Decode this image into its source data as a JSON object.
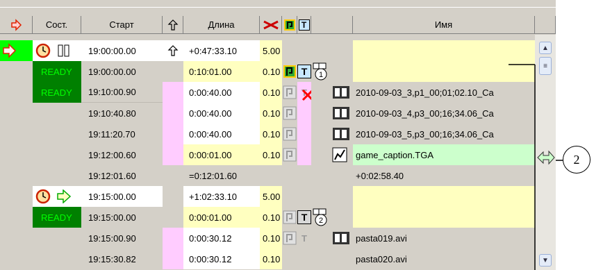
{
  "header": {
    "state": "Сост.",
    "start": "Старт",
    "length": "Длина",
    "name": "Имя"
  },
  "rows": [
    {
      "start": "19:00:00.00",
      "length": "+0:47:33.10",
      "speed": "5.00",
      "name": ""
    },
    {
      "state": "READY",
      "start": "19:00:00.00",
      "length": "0:10:01.00",
      "speed": "0.10",
      "name": ""
    },
    {
      "state": "READY",
      "start": "19:10:00.90",
      "length": "0:00:40.00",
      "speed": "0.10",
      "name": "2010-09-03_3,p1_00;01;02.10_Ca"
    },
    {
      "start": "19:10:40.80",
      "length": "0:00:40.00",
      "speed": "0.10",
      "name": "2010-09-03_4,p3_00;16;34.06_Ca"
    },
    {
      "start": "19:11:20.70",
      "length": "0:00:40.00",
      "speed": "0.10",
      "name": "2010-09-03_5,p3_00;16;34.06_Ca"
    },
    {
      "start": "19:12:00.60",
      "length": "0:00:01.00",
      "speed": "0.10",
      "name": "game_caption.TGA"
    },
    {
      "start": "19:12:01.60",
      "length": "=0:12:01.60",
      "speed": "",
      "name": "+0:02:58.40"
    },
    {
      "start": "19:15:00.00",
      "length": "+1:02:33.10",
      "speed": "5.00",
      "name": ""
    },
    {
      "state": "READY",
      "start": "19:15:00.00",
      "length": "0:00:01.00",
      "speed": "0.10",
      "name": ""
    },
    {
      "start": "19:15:00.90",
      "length": "0:00:30.12",
      "speed": "0.10",
      "name": "pasta019.avi"
    },
    {
      "start": "19:15:30.82",
      "length": "0:00:30.12",
      "speed": "0.10",
      "name": "pasta020.avi"
    }
  ],
  "badges": {
    "one": "1",
    "two": "2"
  },
  "t_label": "T",
  "callout": "2",
  "colors": {
    "ready_bg": "#008000",
    "ready_fg": "#00ff00",
    "time_yellow": "#ffffc0",
    "pink": "#ffccff",
    "green": "#ccffcc",
    "arrow": "#ff3300"
  }
}
